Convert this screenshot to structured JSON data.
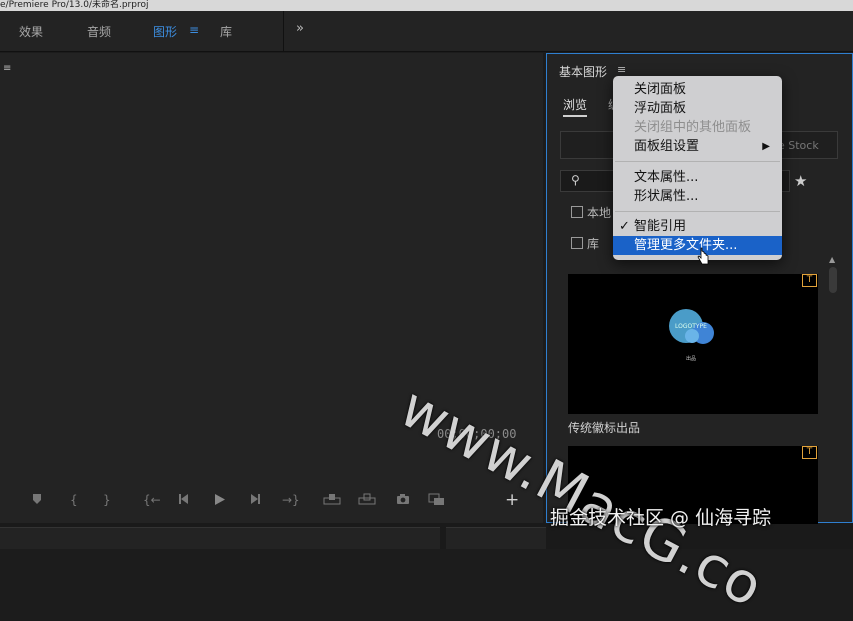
{
  "title_bar": {
    "text": "e/Premiere Pro/13.0/未命名.prproj"
  },
  "workspace_tabs": [
    {
      "label": "效果",
      "active": false
    },
    {
      "label": "音频",
      "active": false
    },
    {
      "label": "图形",
      "active": true
    },
    {
      "label": "库",
      "active": false
    }
  ],
  "workspace_more_icon": "double-chevron-right-icon",
  "program_monitor": {
    "timecode": "00;00;00;00",
    "controls": [
      "marker-icon",
      "in-point-icon",
      "out-point-icon",
      "go-to-in-icon",
      "step-back-icon",
      "play-icon",
      "step-forward-icon",
      "go-to-out-icon",
      "lift-icon",
      "extract-icon",
      "camera-icon",
      "compare-icon",
      "add-icon"
    ]
  },
  "essential_graphics": {
    "title": "基本图形",
    "tabs": {
      "browse": "浏览",
      "edit_partial": "编"
    },
    "stock_text": "be Stock",
    "checkboxes": [
      {
        "label": "本地",
        "checked": false
      },
      {
        "label": "库",
        "checked": false
      }
    ],
    "templates": [
      {
        "caption": "传统徽标出品",
        "badge": "T",
        "logo_text": "LOGOTYPE",
        "logo_sub": "出品"
      },
      {
        "caption": "",
        "badge": "T"
      }
    ]
  },
  "context_menu": {
    "items": [
      {
        "label": "关闭面板",
        "disabled": false
      },
      {
        "label": "浮动面板",
        "disabled": false
      },
      {
        "label": "关闭组中的其他面板",
        "disabled": true
      },
      {
        "label": "面板组设置",
        "disabled": false,
        "submenu": true
      },
      {
        "label": "文本属性...",
        "disabled": false
      },
      {
        "label": "形状属性...",
        "disabled": false
      },
      {
        "label": "智能引用",
        "disabled": false,
        "checked": true
      },
      {
        "label": "管理更多文件夹...",
        "disabled": false,
        "selected": true
      }
    ]
  },
  "overlay": {
    "watermark": "www.MacG.co",
    "credit": "掘金技术社区 @ 仙海寻踪"
  }
}
